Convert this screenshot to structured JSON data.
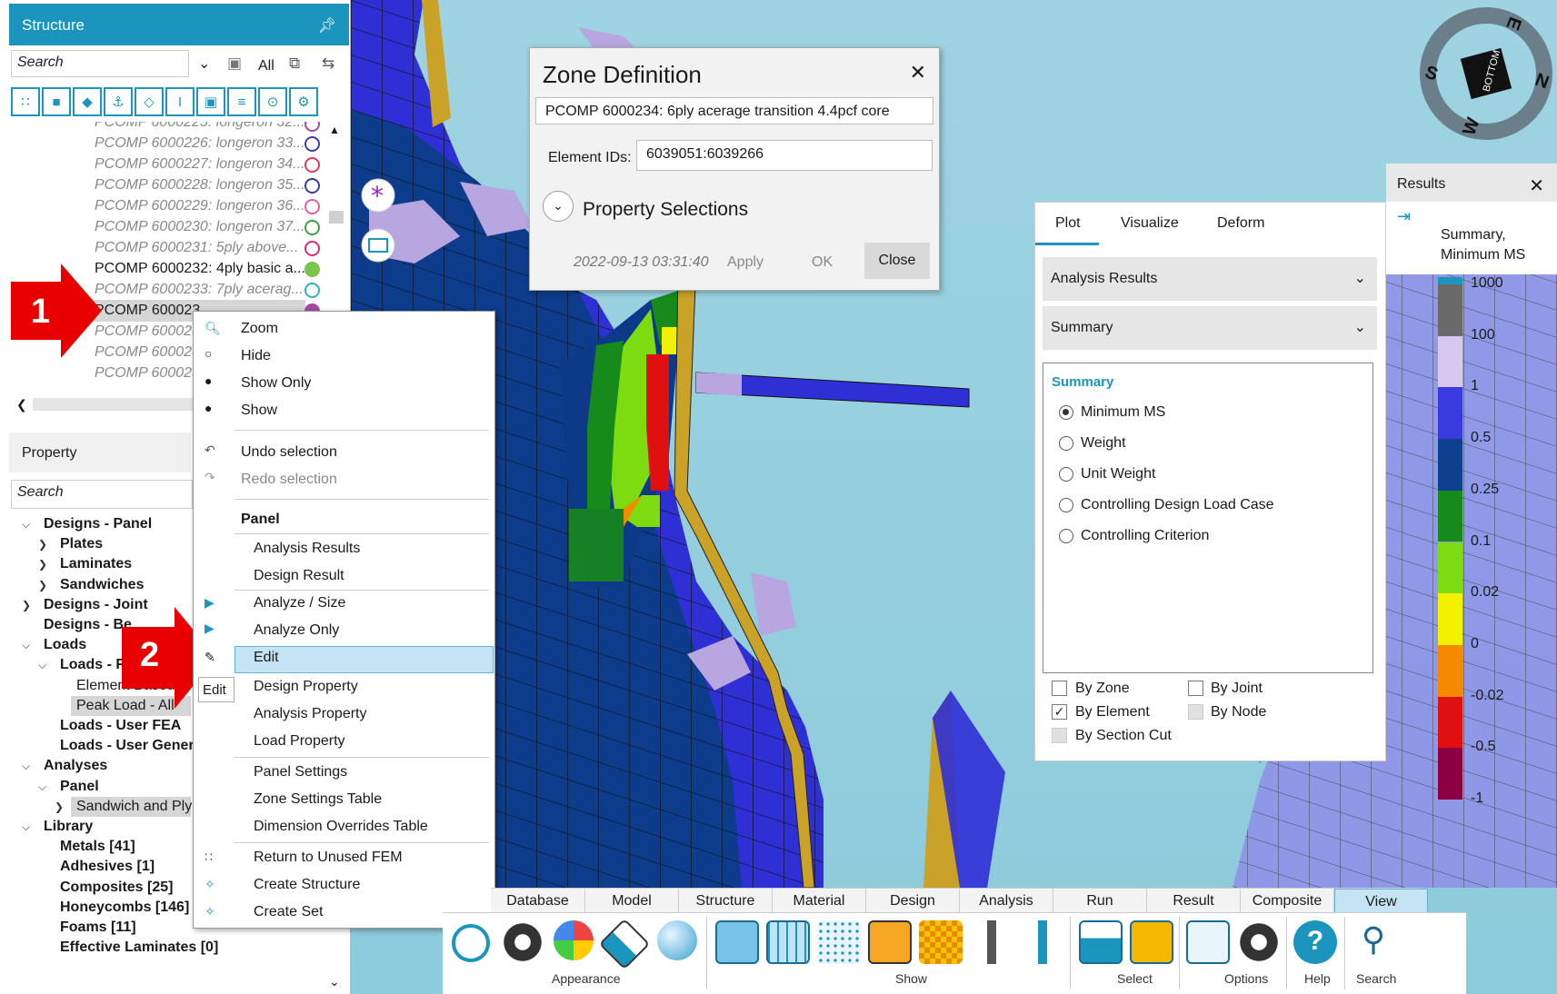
{
  "structure_panel": {
    "title": "Structure",
    "search_placeholder": "Search",
    "all_label": "All",
    "items": [
      {
        "label": "PCOMP 6000225: longeron 32...",
        "color": "#a349a4"
      },
      {
        "label": "PCOMP 6000226: longeron 33...",
        "color": "#4040a0"
      },
      {
        "label": "PCOMP 6000227: longeron 34...",
        "color": "#d04060"
      },
      {
        "label": "PCOMP 6000228: longeron 35...",
        "color": "#3040a0"
      },
      {
        "label": "PCOMP 6000229: longeron 36...",
        "color": "#e060a0"
      },
      {
        "label": "PCOMP 6000230: longeron 37...",
        "color": "#40a040"
      },
      {
        "label": "PCOMP 6000231: 5ply above...",
        "color": "#d03080"
      },
      {
        "label": "PCOMP 6000232: 4ply basic a...",
        "color": "#7cc44a"
      },
      {
        "label": "PCOMP 6000233: 7ply acerag...",
        "color": "#30b0c0"
      },
      {
        "label": "PCOMP 600023...",
        "color": "#a349a4"
      },
      {
        "label": "PCOMP 600023...",
        "color": ""
      },
      {
        "label": "PCOMP 600023...",
        "color": ""
      },
      {
        "label": "PCOMP 600023...",
        "color": ""
      }
    ],
    "selected_label": "PCOMP 600023"
  },
  "property_panel": {
    "title": "Property",
    "search_placeholder": "Search",
    "tree": [
      {
        "label": "Designs - Panel",
        "level": 0,
        "bold": true
      },
      {
        "label": "Plates",
        "level": 1,
        "bold": true
      },
      {
        "label": "Laminates",
        "level": 1,
        "bold": true
      },
      {
        "label": "Sandwiches",
        "level": 1,
        "bold": true
      },
      {
        "label": "Designs - Joint",
        "level": 0,
        "bold": true
      },
      {
        "label": "Designs - Be",
        "level": 0,
        "bold": true
      },
      {
        "label": "Loads",
        "level": 0,
        "bold": true
      },
      {
        "label": "Loads - FEA",
        "level": 1,
        "bold": true
      },
      {
        "label": "Element Based - A",
        "level": 2,
        "bold": false
      },
      {
        "label": "Peak Load - All",
        "level": 2,
        "bold": false
      },
      {
        "label": "Loads - User FEA",
        "level": 1,
        "bold": true
      },
      {
        "label": "Loads - User Genera",
        "level": 1,
        "bold": true
      },
      {
        "label": "Analyses",
        "level": 0,
        "bold": true
      },
      {
        "label": "Panel",
        "level": 1,
        "bold": true
      },
      {
        "label": "Sandwich and Ply",
        "level": 2,
        "bold": false
      },
      {
        "label": "Library",
        "level": 0,
        "bold": true
      },
      {
        "label": "Metals [41]",
        "level": 1,
        "bold": true
      },
      {
        "label": "Adhesives [1]",
        "level": 1,
        "bold": true
      },
      {
        "label": "Composites [25]",
        "level": 1,
        "bold": true
      },
      {
        "label": "Honeycombs [146]",
        "level": 1,
        "bold": true
      },
      {
        "label": "Foams [11]",
        "level": 1,
        "bold": true
      },
      {
        "label": "Effective Laminates [0]",
        "level": 1,
        "bold": true
      }
    ]
  },
  "context_menu": {
    "zoom": "Zoom",
    "hide": "Hide",
    "show_only": "Show Only",
    "show": "Show",
    "undo": "Undo selection",
    "redo": "Redo selection",
    "panel_header": "Panel",
    "analysis_results": "Analysis Results",
    "design_result": "Design Result",
    "analyze_size": "Analyze / Size",
    "analyze_only": "Analyze Only",
    "edit": "Edit",
    "design_property": "Design Property",
    "analysis_property": "Analysis Property",
    "load_property": "Load Property",
    "panel_settings": "Panel Settings",
    "zone_settings": "Zone Settings Table",
    "dimension_overrides": "Dimension Overrides Table",
    "return_unused": "Return to Unused FEM",
    "create_structure": "Create Structure",
    "create_set": "Create Set",
    "edit_tooltip": "Edit"
  },
  "callouts": {
    "one": "1",
    "two": "2"
  },
  "zone_dialog": {
    "title": "Zone Definition",
    "name": "PCOMP 6000234: 6ply acerage transition 4.4pcf core",
    "element_ids_label": "Element IDs:",
    "element_ids": "6039051:6039266",
    "property_selections": "Property Selections",
    "timestamp": "2022-09-13 03:31:40",
    "apply": "Apply",
    "ok": "OK",
    "close": "Close"
  },
  "results_panel": {
    "title": "Results",
    "summary_label": "Summary,",
    "summary_label2": "Minimum MS"
  },
  "plot_panel": {
    "tabs": [
      "Plot",
      "Visualize",
      "Deform"
    ],
    "dropdown1": "Analysis Results",
    "dropdown2": "Summary",
    "summary_header": "Summary",
    "options": [
      "Minimum MS",
      "Weight",
      "Unit Weight",
      "Controlling Design Load Case",
      "Controlling Criterion"
    ],
    "selected_option": 0,
    "checks": {
      "by_zone": "By Zone",
      "by_joint": "By Joint",
      "by_element": "By Element",
      "by_node": "By Node",
      "by_section_cut": "By Section Cut"
    }
  },
  "legend": {
    "labels": [
      "1000",
      "100",
      "1",
      "0.5",
      "0.25",
      "0.1",
      "0.02",
      "0",
      "-0.02",
      "-0.5",
      "-1"
    ],
    "colors": [
      "#6a6a6a",
      "#d9c8ee",
      "#3a3ae0",
      "#0f3f8f",
      "#168a1a",
      "#7ddc10",
      "#f2f200",
      "#f58a00",
      "#e01010",
      "#8a0040"
    ]
  },
  "ribbon": {
    "tabs": [
      "Database",
      "Model",
      "Structure",
      "Material",
      "Design",
      "Analysis",
      "Run",
      "Result",
      "Composite",
      "View"
    ],
    "active_tab": "View",
    "groups": [
      "Appearance",
      "Show",
      "Select",
      "Options",
      "Help",
      "Search"
    ]
  },
  "compass": {
    "label": "BOTTOM",
    "letters": [
      "E",
      "N",
      "W",
      "S"
    ]
  }
}
